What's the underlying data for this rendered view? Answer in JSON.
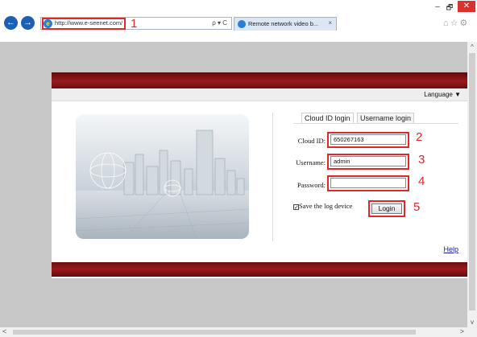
{
  "browser": {
    "url": "http://www.e-seenet.com/",
    "tab_title": "Remote network video b...",
    "tab_close": "×",
    "address_tools": "ρ ▾ C",
    "back": "←",
    "forward": "→",
    "window": {
      "minimize": "–",
      "maximize": "🗗",
      "close": "✕"
    },
    "right_tools": "⌂☆⚙"
  },
  "callouts": [
    "1",
    "2",
    "3",
    "4",
    "5"
  ],
  "login_page": {
    "language_label": "Language ▼",
    "tabs": [
      {
        "label": "Cloud ID login",
        "active": true
      },
      {
        "label": "Username login",
        "active": false
      }
    ],
    "fields": {
      "cloud_id": {
        "label": "Cloud ID:",
        "value": "650267163"
      },
      "username": {
        "label": "Username:",
        "value": "admin"
      },
      "password": {
        "label": "Password:",
        "value": ""
      }
    },
    "save_device": {
      "label": "Save the log device",
      "checked": true
    },
    "login_button": "Login",
    "help_link": "Help"
  },
  "scrollbars": {
    "up": "^",
    "down": "v",
    "left": "<",
    "right": ">"
  },
  "colors": {
    "banner": "#8a1618",
    "callout": "#e2272b",
    "background": "#c8c8c8"
  }
}
